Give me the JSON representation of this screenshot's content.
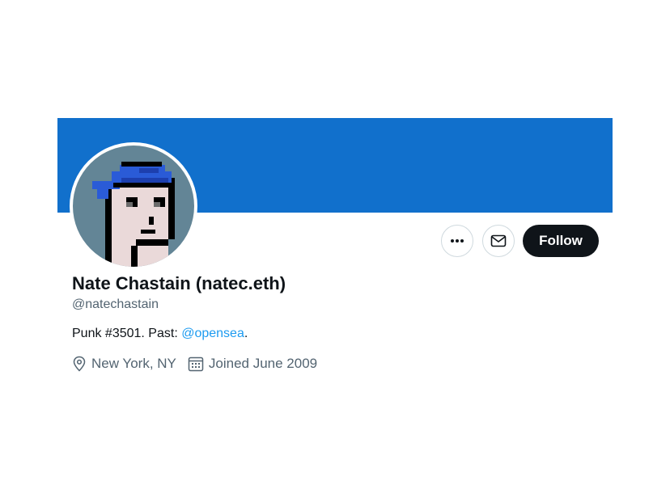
{
  "profile": {
    "display_name": "Nate Chastain (natec.eth)",
    "handle": "@natechastain",
    "bio_prefix": "Punk #3501. Past: ",
    "bio_mention": "@opensea",
    "bio_suffix": ".",
    "location": "New York, NY",
    "joined": "Joined June 2009"
  },
  "actions": {
    "more_icon": "more-horizontal-icon",
    "message_icon": "envelope-icon",
    "follow_label": "Follow"
  },
  "colors": {
    "banner": "#1170cc",
    "avatar_bg": "#638596",
    "follow_bg": "#0f1419",
    "mention": "#1d9bf0",
    "secondary_text": "#536471"
  }
}
